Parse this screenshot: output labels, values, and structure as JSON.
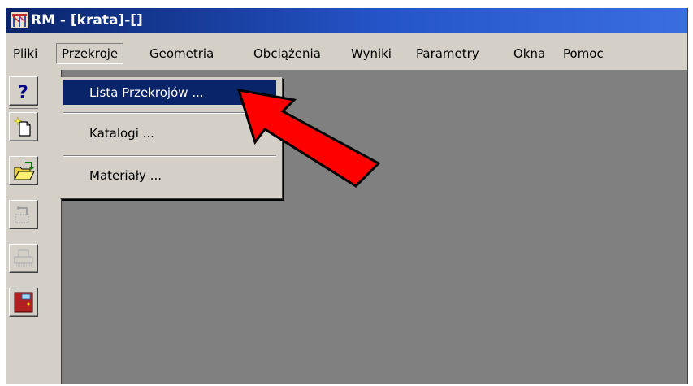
{
  "window": {
    "title": "RM - [krata]-[]"
  },
  "menubar": {
    "items": [
      "Pliki",
      "Przekroje",
      "Geometria",
      "Obciążenia",
      "Wyniki",
      "Parametry",
      "Okna",
      "Pomoc"
    ],
    "active": "Przekroje"
  },
  "dropdown": {
    "items": [
      "Lista Przekrojów ...",
      "Katalogi ...",
      "Materiały ..."
    ],
    "highlighted": "Lista Przekrojów ..."
  },
  "toolbar": {
    "buttons": [
      "help-icon",
      "new-file-icon",
      "open-folder-icon",
      "disabled-tool-icon",
      "disabled-print-icon",
      "exit-door-icon"
    ]
  },
  "colors": {
    "titlebar": "#0a246a",
    "menu_highlight": "#0a246a",
    "arrow": "#ff0000",
    "workspace": "#808080"
  }
}
